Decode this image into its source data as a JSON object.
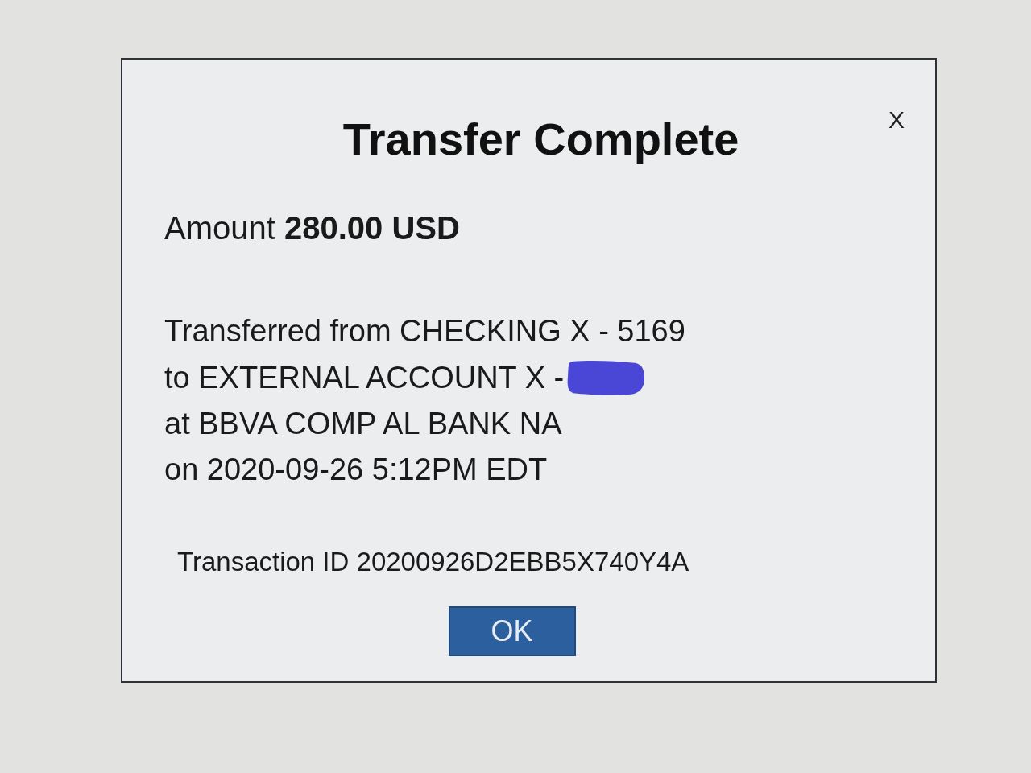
{
  "dialog": {
    "close": "X",
    "title": "Transfer Complete",
    "amount": "Amount **280.00 USD**",
    "details": [
      {
        "text": "Transferred from CHECKING X - 5169",
        "redacted": false
      },
      {
        "text": "to EXTERNAL ACCOUNT X -",
        "redacted": true
      },
      {
        "text": "at BBVA COMP AL BANK NA",
        "redacted": false
      },
      {
        "text": "on 2020-09-26 5:12PM EDT",
        "redacted": false
      }
    ],
    "transaction_id": "Transaction ID 20200926D2EBB5X740Y4A",
    "buttons": [
      "OK"
    ]
  }
}
